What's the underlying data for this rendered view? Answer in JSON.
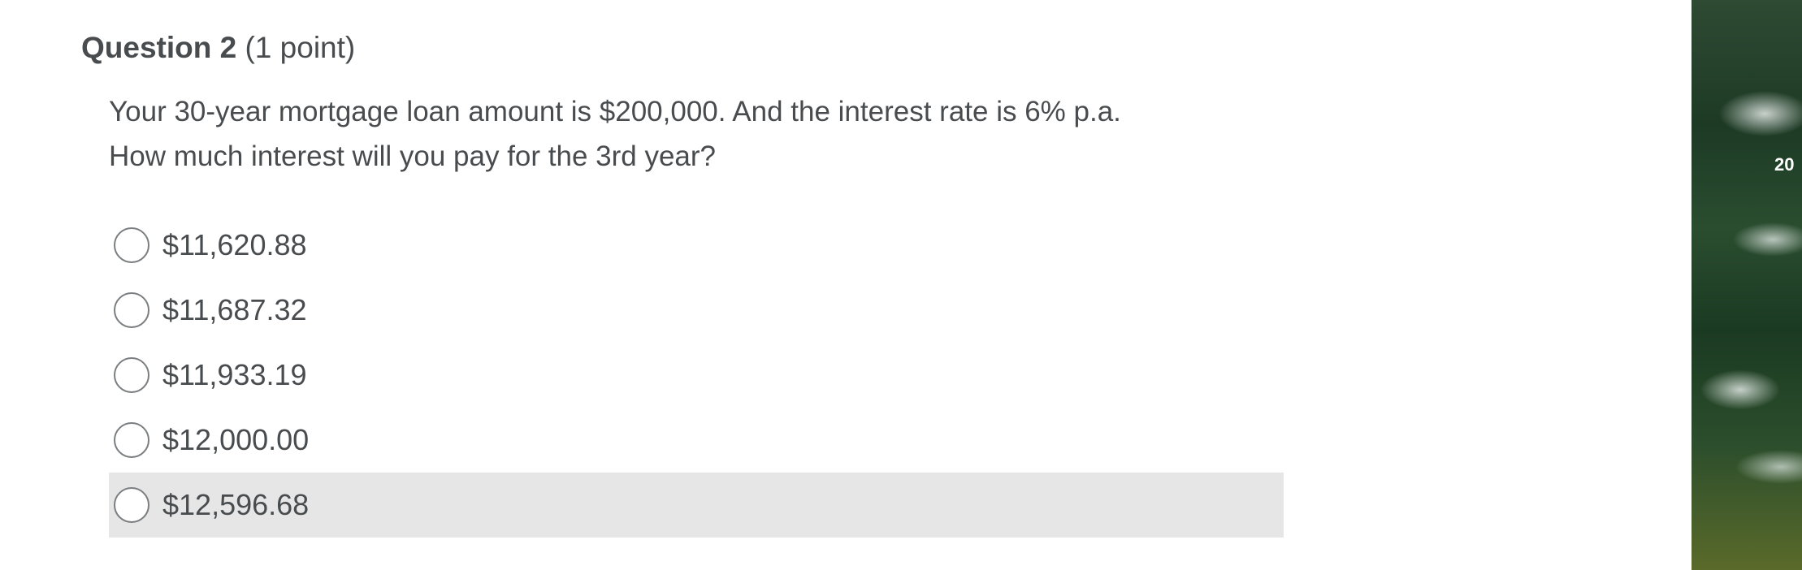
{
  "question": {
    "title": "Question 2",
    "points": "(1 point)",
    "lines": [
      "Your 30-year mortgage loan amount is $200,000. And the interest rate is 6% p.a.",
      "How much interest will you pay for the 3rd year?"
    ],
    "options": [
      {
        "label": "$11,620.88",
        "selected": false
      },
      {
        "label": "$11,687.32",
        "selected": false
      },
      {
        "label": "$11,933.19",
        "selected": false
      },
      {
        "label": "$12,000.00",
        "selected": false
      },
      {
        "label": "$12,596.68",
        "selected": false,
        "hovered": true
      }
    ]
  },
  "background": {
    "partial_text": "20"
  },
  "colors": {
    "text": "#494c4e",
    "hover_bg": "#e6e6e6",
    "radio_border": "#7a7e80"
  }
}
